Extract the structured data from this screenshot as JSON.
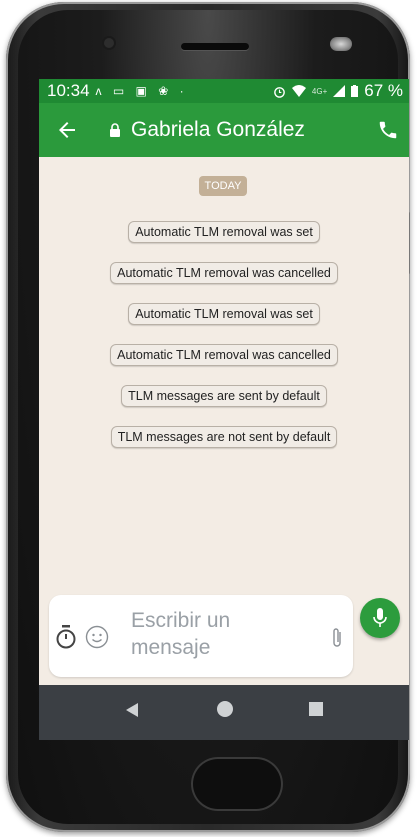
{
  "status_bar": {
    "time": "10:34",
    "notification_icons": "ʌ ▭ ▣ ❀ ·",
    "battery_percent": "67 %",
    "signal_label": "4G+"
  },
  "app_bar": {
    "contact_name": "Gabriela González"
  },
  "chat": {
    "date_label": "TODAY",
    "system_messages": [
      "Automatic TLM removal was set",
      "Automatic TLM removal was cancelled",
      "Automatic TLM removal was set",
      "Automatic TLM removal was cancelled",
      "TLM messages are sent by default",
      "TLM messages are not sent by default"
    ]
  },
  "composer": {
    "placeholder": "Escribir un mensaje"
  },
  "colors": {
    "app_bar": "#2b9a3c",
    "status_bar": "#1f8a33",
    "chat_background": "#f3ece4",
    "date_pill": "#c3b097",
    "nav_bar": "#3b3f44"
  }
}
